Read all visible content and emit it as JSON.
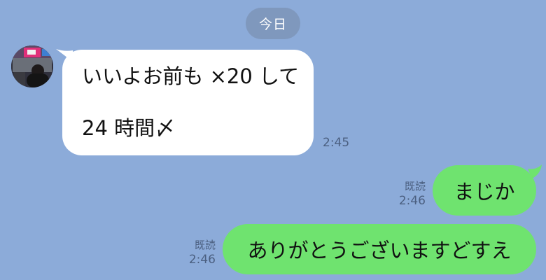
{
  "date_divider": "今日",
  "messages": [
    {
      "direction": "incoming",
      "lines": [
        "いいよお前も ×20 して",
        "24 時間〆"
      ],
      "time": "2:45"
    },
    {
      "direction": "outgoing",
      "text": "まじか",
      "read": "既読",
      "time": "2:46"
    },
    {
      "direction": "outgoing",
      "text": "ありがとうございますどすえ",
      "read": "既読",
      "time": "2:46"
    }
  ],
  "colors": {
    "background": "#8CABD9",
    "incoming_bubble": "#FFFFFF",
    "outgoing_bubble": "#6FE36F",
    "date_pill": "#7F98BD",
    "meta_text": "#4B5F80"
  }
}
